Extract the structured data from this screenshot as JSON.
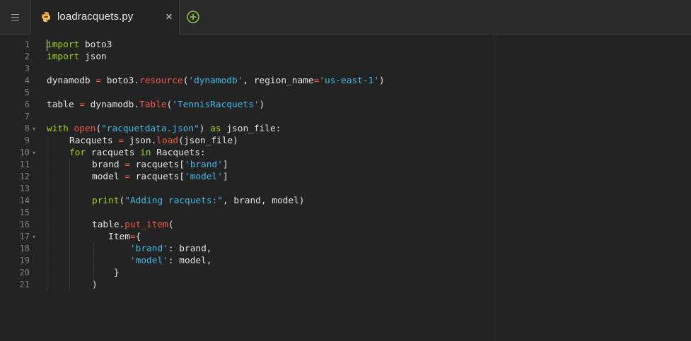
{
  "tabbar": {
    "menu_icon": "hamburger-menu-icon",
    "tabs": [
      {
        "label": "loadracquets.py",
        "icon": "python-file-icon",
        "close_icon": "close-icon",
        "close_glyph": "×"
      }
    ],
    "add_tab_icon": "plus-circle-icon"
  },
  "colors": {
    "keyword": "#9cd61f",
    "function": "#f05a4a",
    "string": "#45b8e6",
    "text": "#e4e4e4",
    "line_number": "#7f7f7f",
    "background": "#232323",
    "add_tab": "#8fc13a"
  },
  "editor": {
    "lines": [
      {
        "num": "1",
        "fold": false,
        "indent": 0,
        "tokens": [
          [
            "kw",
            "import"
          ],
          [
            "plain",
            " boto3"
          ]
        ]
      },
      {
        "num": "2",
        "fold": false,
        "indent": 0,
        "tokens": [
          [
            "kw",
            "import"
          ],
          [
            "plain",
            " json"
          ]
        ]
      },
      {
        "num": "3",
        "fold": false,
        "indent": 0,
        "tokens": []
      },
      {
        "num": "4",
        "fold": false,
        "indent": 0,
        "tokens": [
          [
            "plain",
            "dynamodb "
          ],
          [
            "op",
            "="
          ],
          [
            "plain",
            " boto3."
          ],
          [
            "fn",
            "resource"
          ],
          [
            "plain",
            "("
          ],
          [
            "str",
            "'dynamodb'"
          ],
          [
            "plain",
            ", region_name"
          ],
          [
            "op",
            "="
          ],
          [
            "str",
            "'us-east-1'"
          ],
          [
            "plain",
            ")"
          ]
        ]
      },
      {
        "num": "5",
        "fold": false,
        "indent": 0,
        "tokens": []
      },
      {
        "num": "6",
        "fold": false,
        "indent": 0,
        "tokens": [
          [
            "plain",
            "table "
          ],
          [
            "op",
            "="
          ],
          [
            "plain",
            " dynamodb."
          ],
          [
            "fn",
            "Table"
          ],
          [
            "plain",
            "("
          ],
          [
            "str",
            "'TennisRacquets'"
          ],
          [
            "plain",
            ")"
          ]
        ]
      },
      {
        "num": "7",
        "fold": false,
        "indent": 0,
        "tokens": []
      },
      {
        "num": "8",
        "fold": true,
        "indent": 0,
        "tokens": [
          [
            "kw",
            "with"
          ],
          [
            "plain",
            " "
          ],
          [
            "fn",
            "open"
          ],
          [
            "plain",
            "("
          ],
          [
            "str",
            "\"racquetdata.json\""
          ],
          [
            "plain",
            ") "
          ],
          [
            "kw",
            "as"
          ],
          [
            "plain",
            " json_file:"
          ]
        ]
      },
      {
        "num": "9",
        "fold": false,
        "indent": 1,
        "tokens": [
          [
            "plain",
            "Racquets "
          ],
          [
            "op",
            "="
          ],
          [
            "plain",
            " json."
          ],
          [
            "fn",
            "load"
          ],
          [
            "plain",
            "(json_file)"
          ]
        ]
      },
      {
        "num": "10",
        "fold": true,
        "indent": 1,
        "tokens": [
          [
            "kw",
            "for"
          ],
          [
            "plain",
            " racquets "
          ],
          [
            "kw",
            "in"
          ],
          [
            "plain",
            " Racquets:"
          ]
        ]
      },
      {
        "num": "11",
        "fold": false,
        "indent": 2,
        "tokens": [
          [
            "plain",
            "brand "
          ],
          [
            "op",
            "="
          ],
          [
            "plain",
            " racquets["
          ],
          [
            "str",
            "'brand'"
          ],
          [
            "plain",
            "]"
          ]
        ]
      },
      {
        "num": "12",
        "fold": false,
        "indent": 2,
        "tokens": [
          [
            "plain",
            "model "
          ],
          [
            "op",
            "="
          ],
          [
            "plain",
            " racquets["
          ],
          [
            "str",
            "'model'"
          ],
          [
            "plain",
            "]"
          ]
        ]
      },
      {
        "num": "13",
        "fold": false,
        "indent": 2,
        "tokens": []
      },
      {
        "num": "14",
        "fold": false,
        "indent": 2,
        "tokens": [
          [
            "kw",
            "print"
          ],
          [
            "plain",
            "("
          ],
          [
            "str",
            "\"Adding racquets:\""
          ],
          [
            "plain",
            ", brand, model)"
          ]
        ]
      },
      {
        "num": "15",
        "fold": false,
        "indent": 2,
        "tokens": []
      },
      {
        "num": "16",
        "fold": false,
        "indent": 2,
        "tokens": [
          [
            "plain",
            "table."
          ],
          [
            "fn",
            "put_item"
          ],
          [
            "plain",
            "("
          ]
        ]
      },
      {
        "num": "17",
        "fold": true,
        "indent": 2,
        "tokens": [
          [
            "plain",
            "   Item"
          ],
          [
            "op",
            "="
          ],
          [
            "plain",
            "{"
          ]
        ]
      },
      {
        "num": "18",
        "fold": false,
        "indent": 2,
        "tokens": [
          [
            "plain",
            "       "
          ],
          [
            "str",
            "'brand'"
          ],
          [
            "plain",
            ": brand,"
          ]
        ]
      },
      {
        "num": "19",
        "fold": false,
        "indent": 2,
        "tokens": [
          [
            "plain",
            "       "
          ],
          [
            "str",
            "'model'"
          ],
          [
            "plain",
            ": model,"
          ]
        ]
      },
      {
        "num": "20",
        "fold": false,
        "indent": 2,
        "tokens": [
          [
            "plain",
            "    }"
          ]
        ]
      },
      {
        "num": "21",
        "fold": false,
        "indent": 2,
        "tokens": [
          [
            "plain",
            ")"
          ]
        ]
      }
    ]
  }
}
